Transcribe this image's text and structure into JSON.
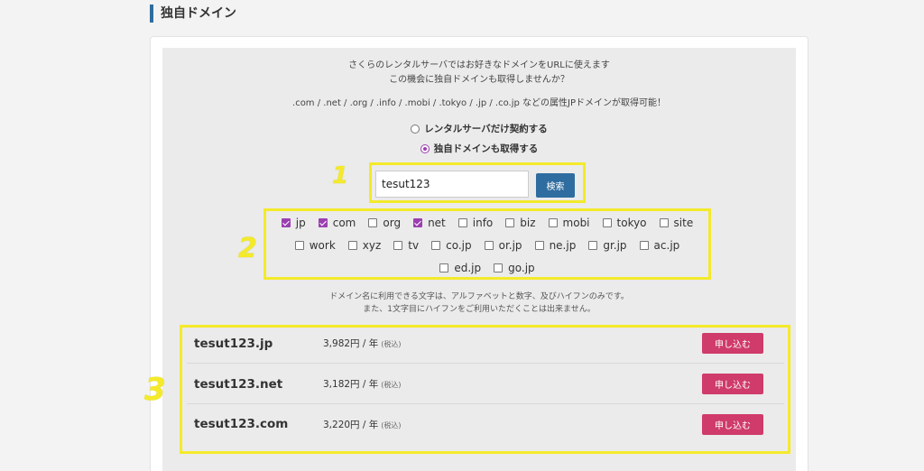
{
  "heading": "独自ドメイン",
  "intro": {
    "line1": "さくらのレンタルサーバではお好きなドメインをURLに使えます",
    "line2": "この機会に独自ドメインも取得しませんか？",
    "tlds": ".com / .net / .org / .info / .mobi / .tokyo / .jp / .co.jp などの属性JPドメインが取得可能！"
  },
  "options": {
    "server_only": "レンタルサーバだけ契約する",
    "with_domain": "独自ドメインも取得する",
    "selected": "with_domain"
  },
  "search": {
    "value": "tesut123",
    "button": "検索"
  },
  "tlds": {
    "row1": [
      {
        "label": "jp",
        "checked": true
      },
      {
        "label": "com",
        "checked": true
      },
      {
        "label": "org",
        "checked": false
      },
      {
        "label": "net",
        "checked": true
      },
      {
        "label": "info",
        "checked": false
      },
      {
        "label": "biz",
        "checked": false
      },
      {
        "label": "mobi",
        "checked": false
      },
      {
        "label": "tokyo",
        "checked": false
      },
      {
        "label": "site",
        "checked": false
      }
    ],
    "row2": [
      {
        "label": "work",
        "checked": false
      },
      {
        "label": "xyz",
        "checked": false
      },
      {
        "label": "tv",
        "checked": false
      },
      {
        "label": "co.jp",
        "checked": false
      },
      {
        "label": "or.jp",
        "checked": false
      },
      {
        "label": "ne.jp",
        "checked": false
      },
      {
        "label": "gr.jp",
        "checked": false
      },
      {
        "label": "ac.jp",
        "checked": false
      }
    ],
    "row3": [
      {
        "label": "ed.jp",
        "checked": false
      },
      {
        "label": "go.jp",
        "checked": false
      }
    ]
  },
  "note": {
    "line1": "ドメイン名に利用できる文字は、アルファベットと数字、及びハイフンのみです。",
    "line2": "また、1文字目にハイフンをご利用いただくことは出来ません。"
  },
  "results": [
    {
      "domain": "tesut123.jp",
      "price": "3,982円 / 年",
      "tax": "(税込)",
      "button": "申し込む"
    },
    {
      "domain": "tesut123.net",
      "price": "3,182円 / 年",
      "tax": "(税込)",
      "button": "申し込む"
    },
    {
      "domain": "tesut123.com",
      "price": "3,220円 / 年",
      "tax": "(税込)",
      "button": "申し込む"
    }
  ],
  "annotations": {
    "one": "1",
    "two": "2",
    "three": "3"
  },
  "colors": {
    "accent_blue": "#2f6da0",
    "purple": "#9b3fb0",
    "apply_pink": "#cf3b6a",
    "highlight_yellow": "#f4ea2a"
  }
}
